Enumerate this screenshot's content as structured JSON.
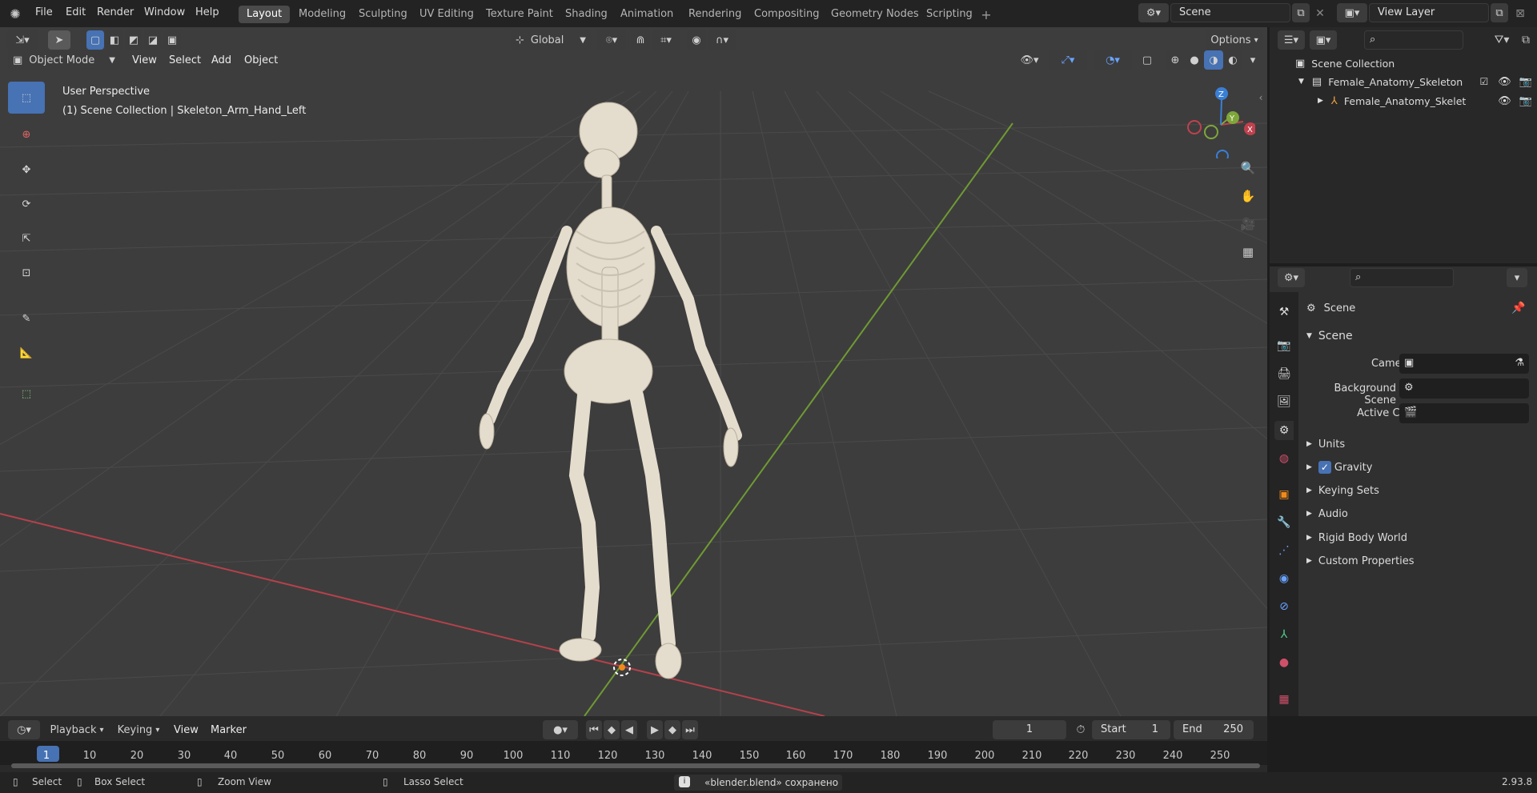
{
  "menu": [
    "File",
    "Edit",
    "Render",
    "Window",
    "Help"
  ],
  "workspaces": [
    "Layout",
    "Modeling",
    "Sculpting",
    "UV Editing",
    "Texture Paint",
    "Shading",
    "Animation",
    "Rendering",
    "Compositing",
    "Geometry Nodes",
    "Scripting"
  ],
  "scene_name": "Scene",
  "view_layer": "View Layer",
  "header": {
    "mode": "Object Mode",
    "view": "View",
    "select": "Select",
    "add": "Add",
    "object": "Object",
    "orientation": "Global",
    "options": "Options"
  },
  "viewport": {
    "perspective": "User Perspective",
    "collection_info": "(1) Scene Collection | Skeleton_Arm_Hand_Left",
    "gizmo": {
      "x": "X",
      "y": "Y",
      "z": "Z"
    }
  },
  "outliner": {
    "root": "Scene Collection",
    "items": [
      {
        "label": "Female_Anatomy_Skeleton"
      },
      {
        "label": "Female_Anatomy_Skelet"
      }
    ]
  },
  "properties": {
    "title": "Scene",
    "section": "Scene",
    "camera_label": "Camera",
    "background_label": "Background Scene",
    "clip_label": "Active Clip",
    "subsections": [
      "Units",
      "Gravity",
      "Keying Sets",
      "Audio",
      "Rigid Body World",
      "Custom Properties"
    ],
    "gravity_checked": true
  },
  "timeline": {
    "playback": "Playback",
    "keying": "Keying",
    "view": "View",
    "marker": "Marker",
    "current_frame": "1",
    "start_label": "Start",
    "start": "1",
    "end_label": "End",
    "end": "250",
    "ruler": [
      "1",
      "10",
      "20",
      "30",
      "40",
      "50",
      "60",
      "70",
      "80",
      "90",
      "100",
      "110",
      "120",
      "130",
      "140",
      "150",
      "160",
      "170",
      "180",
      "190",
      "200",
      "210",
      "220",
      "230",
      "240",
      "250"
    ]
  },
  "status": {
    "select": "Select",
    "box_select": "Box Select",
    "zoom_view": "Zoom View",
    "lasso_select": "Lasso Select",
    "message": "«blender.blend» сохранено",
    "version": "2.93.8"
  },
  "colors": {
    "accent": "#4772b3",
    "x_axis": "#c0414e",
    "y_axis": "#7fa63a",
    "z_axis": "#3a7fd6",
    "bone": "#e4dccd"
  }
}
